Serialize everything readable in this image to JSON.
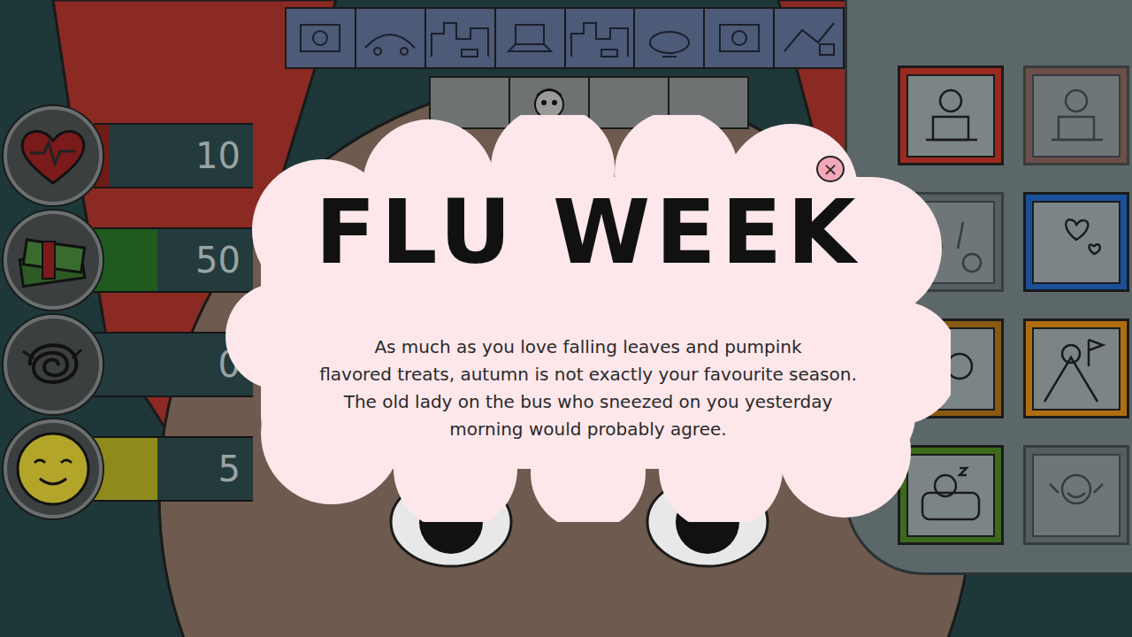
{
  "stats": [
    {
      "name": "health",
      "value": "10",
      "level": 0.1,
      "color": "#6e1c18"
    },
    {
      "name": "money",
      "value": "50",
      "level": 0.4,
      "color": "#1f5a1e"
    },
    {
      "name": "stress",
      "value": "0",
      "level": 0,
      "color": "#3a3a3a"
    },
    {
      "name": "happiness",
      "value": "5",
      "level": 0.4,
      "color": "#8f8a1c"
    }
  ],
  "timeline": [
    {
      "kind": "video"
    },
    {
      "kind": "bus"
    },
    {
      "kind": "city"
    },
    {
      "kind": "laptop"
    },
    {
      "kind": "city"
    },
    {
      "kind": "dinner"
    },
    {
      "kind": "video"
    },
    {
      "kind": "map"
    }
  ],
  "slots": [
    {
      "filled": false
    },
    {
      "filled": true
    },
    {
      "filled": false
    },
    {
      "filled": false
    }
  ],
  "activities": [
    {
      "kind": "work",
      "available": true,
      "color": "#9a2a20"
    },
    {
      "kind": "overtime",
      "available": false,
      "color": "#7a3a34"
    },
    {
      "kind": "party",
      "available": false,
      "color": "#4e5a5c"
    },
    {
      "kind": "date",
      "available": true,
      "color": "#1a4f9a"
    },
    {
      "kind": "doctor",
      "available": true,
      "color": "#8a5a12"
    },
    {
      "kind": "hike",
      "available": true,
      "color": "#b06d10"
    },
    {
      "kind": "rest",
      "available": true,
      "color": "#3c6a1a"
    },
    {
      "kind": "gym",
      "available": false,
      "color": "#4e5a5c"
    }
  ],
  "dialog": {
    "title": "FLU WEEK",
    "body": [
      "As much as you love falling leaves and pumpink",
      "flavored treats, autumn is not exactly your favourite season.",
      "The old lady on the bus who sneezed on you yesterday",
      "morning would probably agree."
    ],
    "close": "×"
  }
}
